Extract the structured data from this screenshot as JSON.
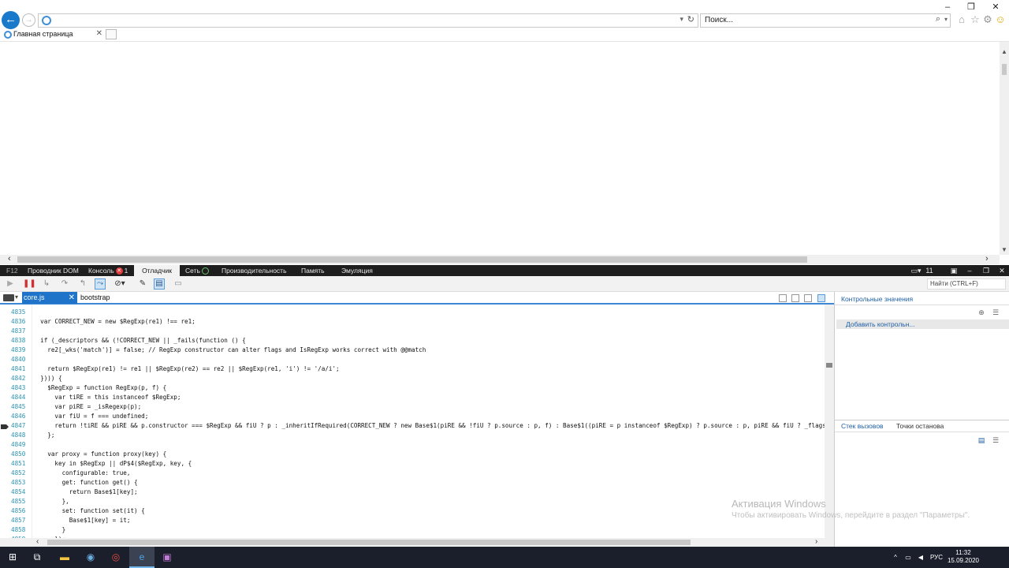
{
  "browser": {
    "address_value": "",
    "search_placeholder": "Поиск...",
    "tab_title": "Главная страница",
    "window_controls": [
      "–",
      "❐",
      "✕"
    ]
  },
  "devtools": {
    "tabs": [
      "F12",
      "Проводник DOM",
      "Консоль",
      "Отладчик",
      "Сеть",
      "Производительность",
      "Память",
      "Эмуляция"
    ],
    "console_error_count": "1",
    "right_counter": "11",
    "find_placeholder": "Найти (CTRL+F)",
    "files": [
      "core.js",
      "bootstrap"
    ],
    "watch_title": "Контрольные значения",
    "add_watch": "Добавить контрольн...",
    "bottom_tabs": [
      "Стек вызовов",
      "Точки останова"
    ]
  },
  "code_lines": [
    {
      "n": "4835",
      "t": ""
    },
    {
      "n": "4836",
      "t": "  var CORRECT_NEW = new $RegExp(re1) !== re1;"
    },
    {
      "n": "4837",
      "t": ""
    },
    {
      "n": "4838",
      "t": "  if (_descriptors && (!CORRECT_NEW || _fails(function () {"
    },
    {
      "n": "4839",
      "t": "    re2[_wks('match')] = false; // RegExp constructor can alter flags and IsRegExp works correct with @@match"
    },
    {
      "n": "4840",
      "t": ""
    },
    {
      "n": "4841",
      "t": "    return $RegExp(re1) != re1 || $RegExp(re2) == re2 || $RegExp(re1, 'i') != '/a/i';"
    },
    {
      "n": "4842",
      "t": "  }))) {"
    },
    {
      "n": "4843",
      "t": "    $RegExp = function RegExp(p, f) {"
    },
    {
      "n": "4844",
      "t": "      var tiRE = this instanceof $RegExp;"
    },
    {
      "n": "4845",
      "t": "      var piRE = _isRegexp(p);"
    },
    {
      "n": "4846",
      "t": "      var fiU = f === undefined;"
    },
    {
      "n": "4847",
      "t": "      return !tiRE && piRE && p.constructor === $RegExp && fiU ? p : _inheritIfRequired(CORRECT_NEW ? new Base$1(piRE && !fiU ? p.source : p, f) : Base$1((piRE = p instanceof $RegExp) ? p.source : p, piRE && fiU ? _flags.call(p)"
    },
    {
      "n": "4848",
      "t": "    };"
    },
    {
      "n": "4849",
      "t": ""
    },
    {
      "n": "4850",
      "t": "    var proxy = function proxy(key) {"
    },
    {
      "n": "4851",
      "t": "      key in $RegExp || dP$4($RegExp, key, {"
    },
    {
      "n": "4852",
      "t": "        configurable: true,"
    },
    {
      "n": "4853",
      "t": "        get: function get() {"
    },
    {
      "n": "4854",
      "t": "          return Base$1[key];"
    },
    {
      "n": "4855",
      "t": "        },"
    },
    {
      "n": "4856",
      "t": "        set: function set(it) {"
    },
    {
      "n": "4857",
      "t": "          Base$1[key] = it;"
    },
    {
      "n": "4858",
      "t": "        }"
    },
    {
      "n": "4859",
      "t": "      });"
    }
  ],
  "watermark": {
    "line1": "Активация Windows",
    "line2": "Чтобы активировать Windows, перейдите в раздел \"Параметры\"."
  },
  "taskbar": {
    "lang": "РУС",
    "time": "11:32",
    "date": "15.09.2020"
  },
  "colors": {
    "accent": "#1f73c8",
    "devtools_bar": "#1e1e1e",
    "taskbar": "#1a1f2b"
  }
}
